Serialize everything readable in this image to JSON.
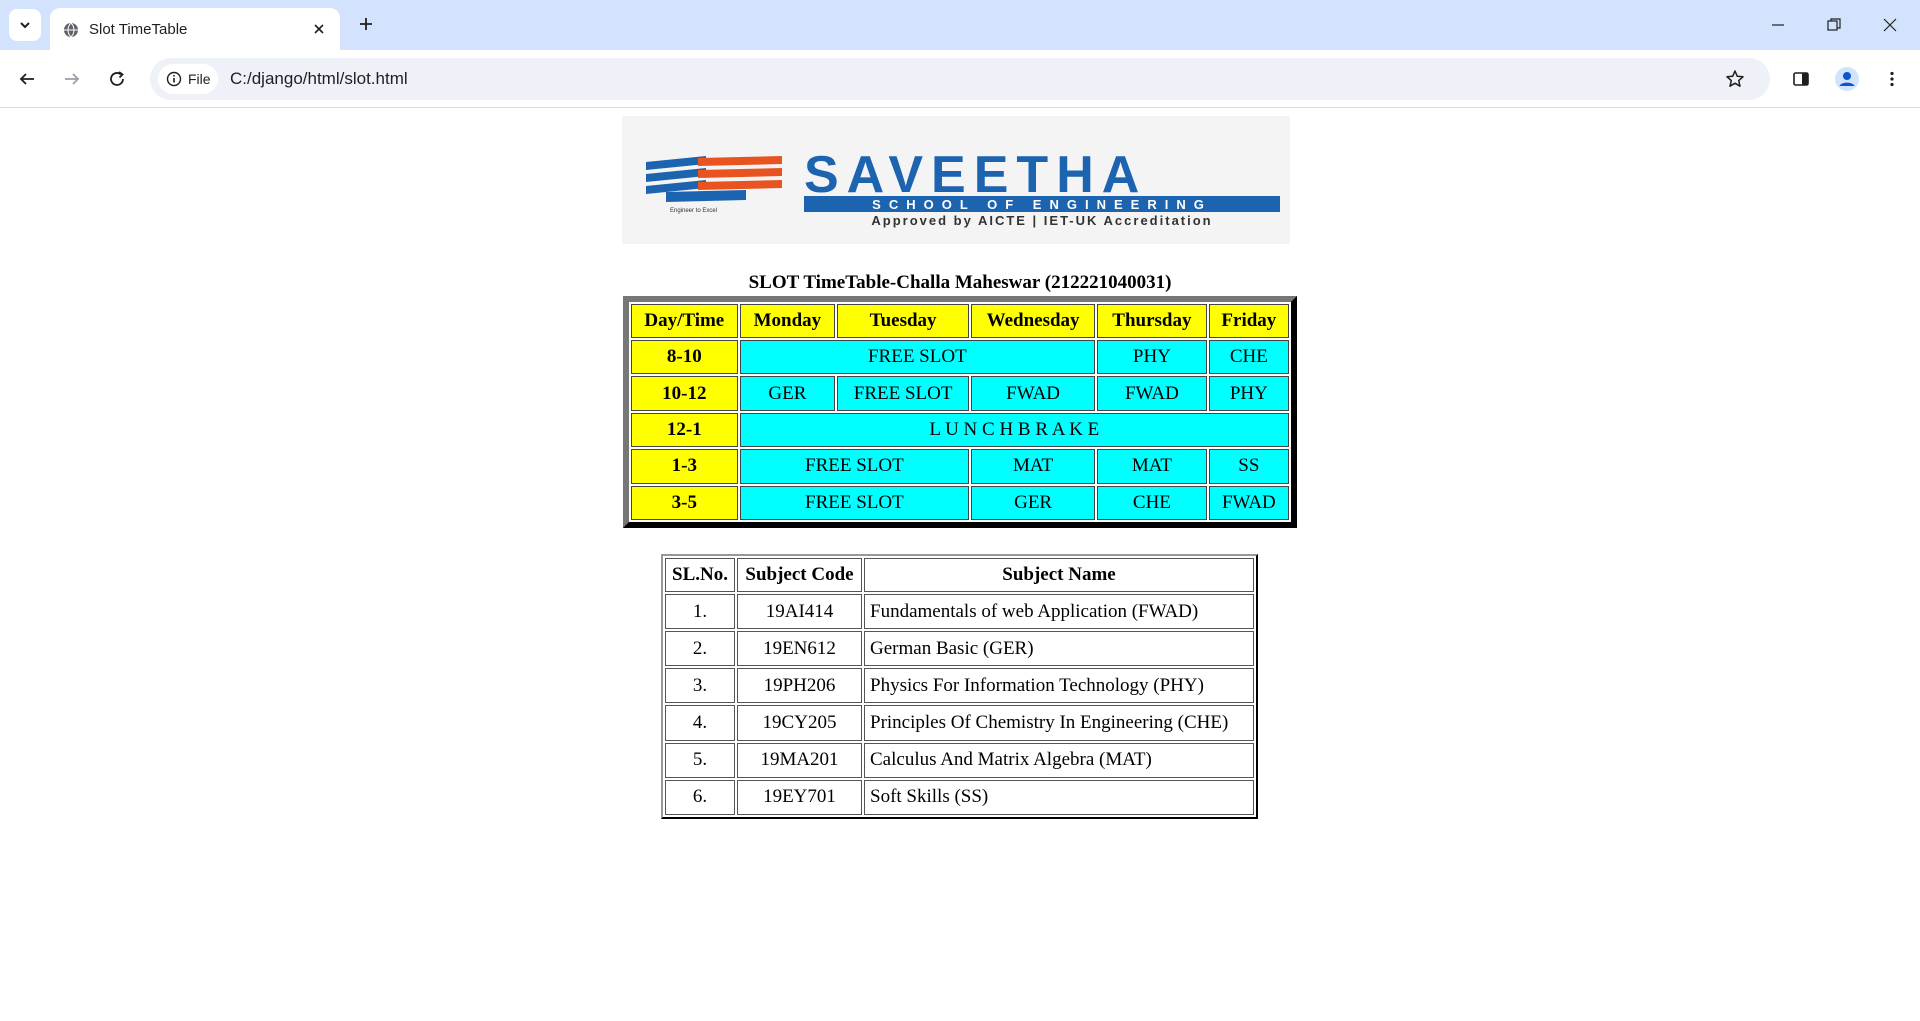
{
  "browser": {
    "tab_title": "Slot TimeTable",
    "chip_label": "File",
    "url": "C:/django/html/slot.html"
  },
  "logo": {
    "name": "SAVEETHA",
    "subtitle": "SCHOOL OF ENGINEERING",
    "tagline": "Approved by AICTE | IET-UK Accreditation",
    "slogan": "Engineer to Excel"
  },
  "page": {
    "title": "SLOT TimeTable-Challa Maheswar (212221040031)"
  },
  "timetable": {
    "headers": [
      "Day/Time",
      "Monday",
      "Tuesday",
      "Wednesday",
      "Thursday",
      "Friday"
    ],
    "rows": [
      {
        "time": "8-10",
        "cells": [
          {
            "text": "FREE SLOT",
            "span": 3
          },
          {
            "text": "PHY",
            "span": 1
          },
          {
            "text": "CHE",
            "span": 1
          }
        ]
      },
      {
        "time": "10-12",
        "cells": [
          {
            "text": "GER",
            "span": 1
          },
          {
            "text": "FREE SLOT",
            "span": 1
          },
          {
            "text": "FWAD",
            "span": 1
          },
          {
            "text": "FWAD",
            "span": 1
          },
          {
            "text": "PHY",
            "span": 1
          }
        ]
      },
      {
        "time": "12-1",
        "cells": [
          {
            "text": "L U N C H B R A K E",
            "span": 5
          }
        ]
      },
      {
        "time": "1-3",
        "cells": [
          {
            "text": "FREE SLOT",
            "span": 2
          },
          {
            "text": "MAT",
            "span": 1
          },
          {
            "text": "MAT",
            "span": 1
          },
          {
            "text": "SS",
            "span": 1
          }
        ]
      },
      {
        "time": "3-5",
        "cells": [
          {
            "text": "FREE SLOT",
            "span": 2
          },
          {
            "text": "GER",
            "span": 1
          },
          {
            "text": "CHE",
            "span": 1
          },
          {
            "text": "FWAD",
            "span": 1
          }
        ]
      }
    ],
    "colors": {
      "header": "#ffff00",
      "cell": "#00ffff"
    }
  },
  "subjects": {
    "headers": [
      "SL.No.",
      "Subject Code",
      "Subject Name"
    ],
    "rows": [
      {
        "no": "1.",
        "code": "19AI414",
        "name": "Fundamentals of web Application (FWAD)"
      },
      {
        "no": "2.",
        "code": "19EN612",
        "name": "German Basic (GER)"
      },
      {
        "no": "3.",
        "code": "19PH206",
        "name": "Physics For Information Technology (PHY)"
      },
      {
        "no": "4.",
        "code": "19CY205",
        "name": "Principles Of Chemistry In Engineering (CHE)"
      },
      {
        "no": "5.",
        "code": "19MA201",
        "name": "Calculus And Matrix Algebra (MAT)"
      },
      {
        "no": "6.",
        "code": "19EY701",
        "name": "Soft Skills (SS)"
      }
    ]
  }
}
